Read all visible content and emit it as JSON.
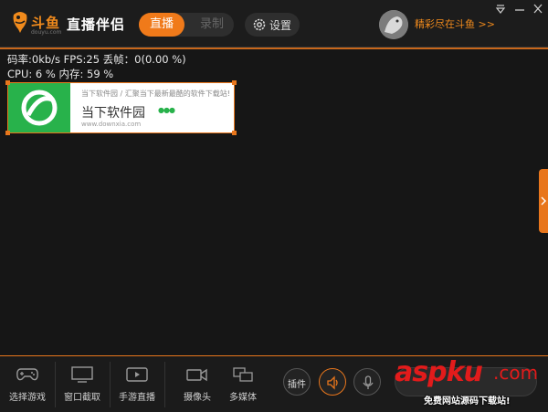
{
  "brand": {
    "logo_text": "斗鱼",
    "logo_sub": "douyu.com",
    "app_title": "直播伴侣"
  },
  "header": {
    "mode_live": "直播",
    "mode_record": "录制",
    "settings": "设置",
    "promo": "精彩尽在斗鱼 >>"
  },
  "stats": {
    "line1": "码率:0kb/s   FPS:25  丢帧：0(0.00 %)",
    "line2": "CPU: 6 %      内存: 59 %"
  },
  "preview": {
    "banner_line1": "当下软件园 / 汇聚当下最新最酷的软件下载站!",
    "banner_title": "当下软件园",
    "banner_url": "www.downxia.com"
  },
  "toolbar": {
    "items": [
      {
        "label": "选择游戏",
        "icon": "gamepad-icon"
      },
      {
        "label": "窗口截取",
        "icon": "monitor-icon"
      },
      {
        "label": "手游直播",
        "icon": "mobile-play-icon"
      },
      {
        "label": "摄像头",
        "icon": "camera-icon"
      },
      {
        "label": "多媒体",
        "icon": "multimedia-icon"
      }
    ],
    "plugin": "插件"
  },
  "watermark": {
    "main": "aspku",
    "suffix": ".com",
    "sub": "免费网站源码下载站!"
  },
  "colors": {
    "accent": "#f07a1a",
    "background": "#161616",
    "watermark": "#e21b1b"
  }
}
